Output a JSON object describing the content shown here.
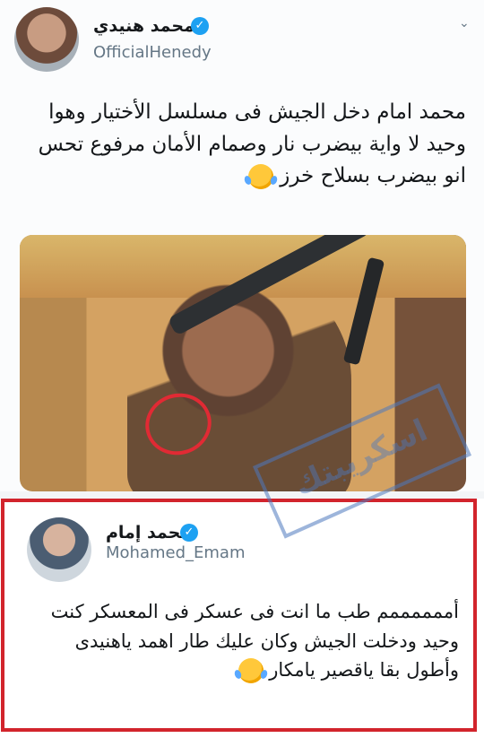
{
  "tweet1": {
    "display_name": "محمد هنيدي",
    "handle": "OfficialHenedy",
    "verified_icon": "verified-badge-icon",
    "text": "محمد امام دخل الجيش فى مسلسل الأختيار وهوا وحيد لا واية بيضرب نار وصمام الأمان مرفوع تحس انو بيضرب بسلاح خرز",
    "media_alt": "",
    "chevron_icon": "chevron-down-icon"
  },
  "tweet2": {
    "display_name": "محمد إمام",
    "handle": "Mohamed_Emam",
    "verified_icon": "verified-badge-icon",
    "text": "أممممممم طب ما انت فى عسكر فى المعسكر كنت وحيد ودخلت الجيش وكان عليك طار اهمد ياهنيدى وأطول بقا ياقصير يامكار"
  },
  "watermark": {
    "text": "اسكريبتك"
  },
  "colors": {
    "accent": "#1da1f2",
    "highlight_border": "#d2242c",
    "circle": "#e12a34"
  }
}
